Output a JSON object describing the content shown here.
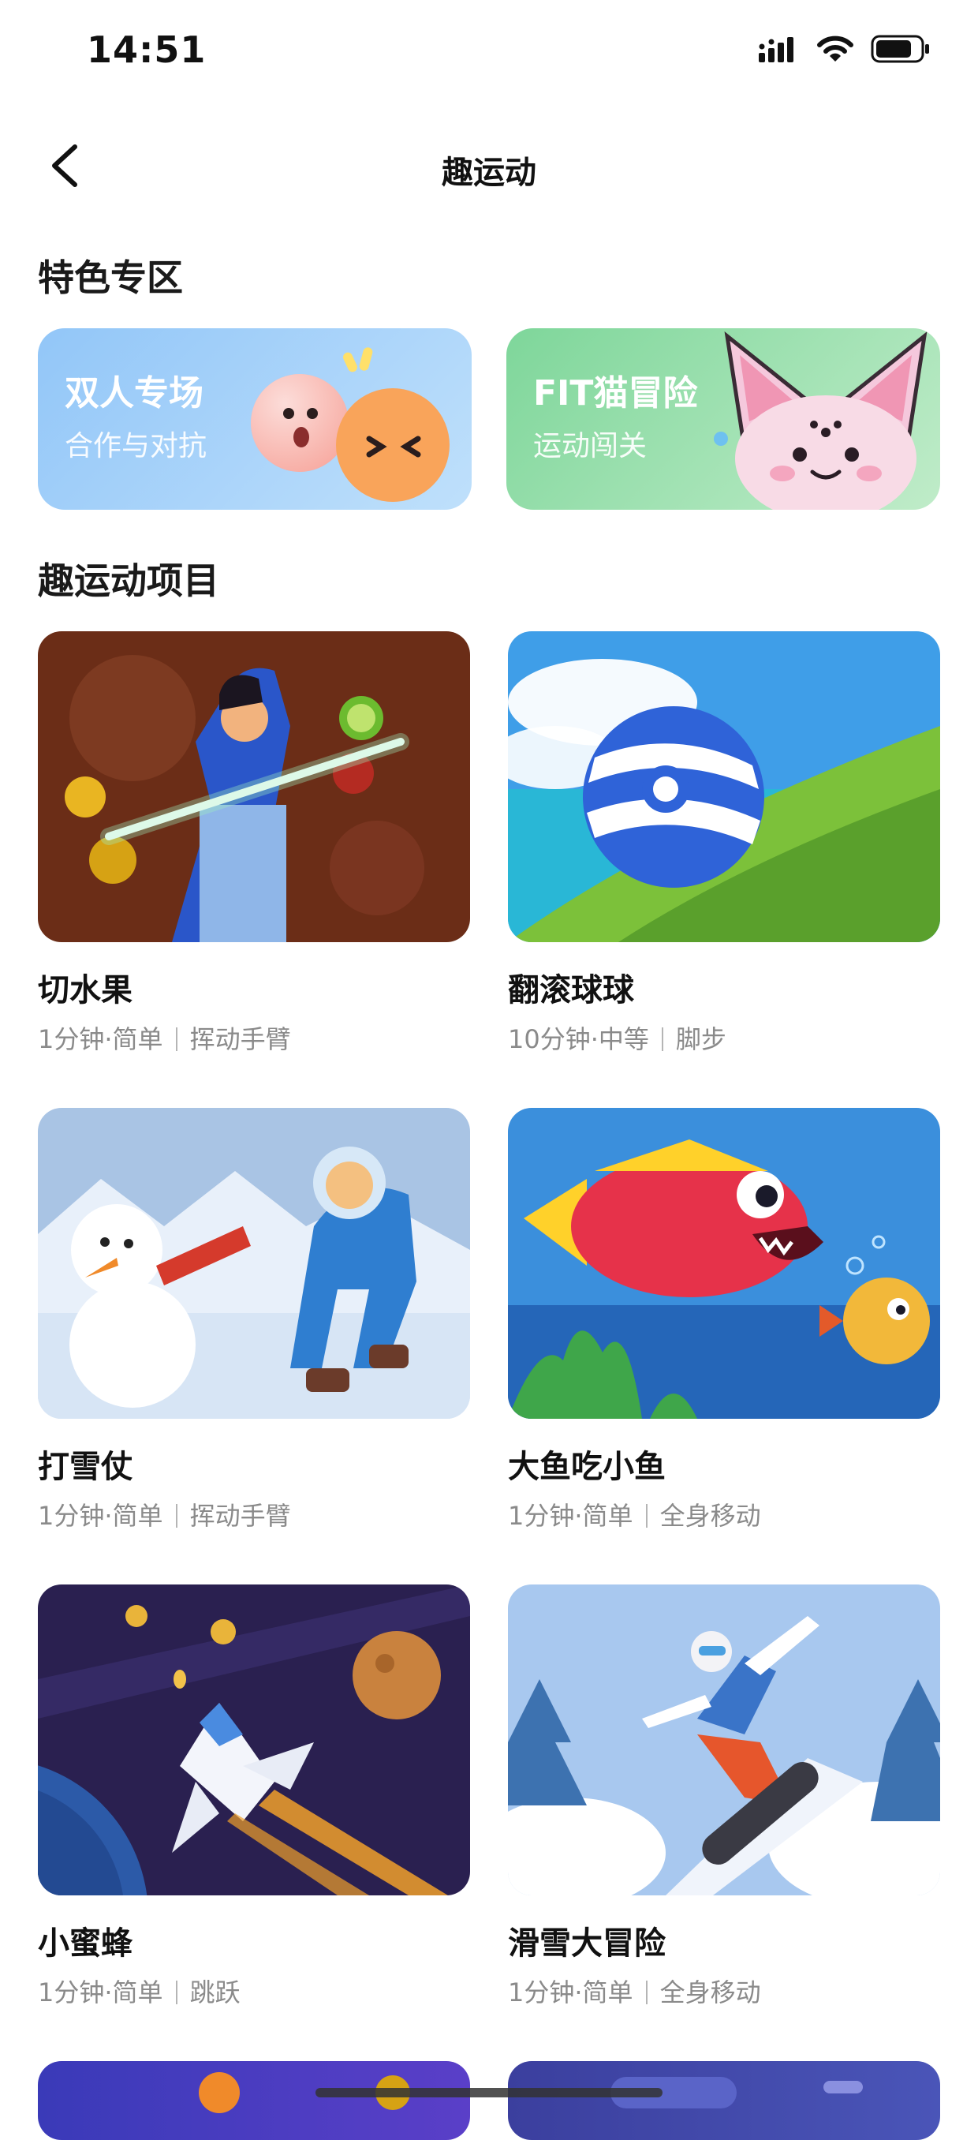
{
  "status_bar": {
    "time": "14:51"
  },
  "nav": {
    "title": "趣运动"
  },
  "featured": {
    "section_title": "特色专区",
    "cards": [
      {
        "title": "双人专场",
        "subtitle": "合作与对抗",
        "colors": [
          "#8fc3f7",
          "#cde6fb"
        ]
      },
      {
        "title": "FIT猫冒险",
        "subtitle": "运动闯关",
        "colors": [
          "#7fd89a",
          "#c8efcf"
        ]
      }
    ]
  },
  "games": {
    "section_title": "趣运动项目",
    "items": [
      {
        "name": "切水果",
        "duration": "1分钟",
        "difficulty": "简单",
        "motion": "挥动手臂"
      },
      {
        "name": "翻滚球球",
        "duration": "10分钟",
        "difficulty": "中等",
        "motion": "脚步"
      },
      {
        "name": "打雪仗",
        "duration": "1分钟",
        "difficulty": "简单",
        "motion": "挥动手臂"
      },
      {
        "name": "大鱼吃小鱼",
        "duration": "1分钟",
        "difficulty": "简单",
        "motion": "全身移动"
      },
      {
        "name": "小蜜蜂",
        "duration": "1分钟",
        "difficulty": "简单",
        "motion": "跳跃"
      },
      {
        "name": "滑雪大冒险",
        "duration": "1分钟",
        "difficulty": "简单",
        "motion": "全身移动"
      }
    ]
  }
}
